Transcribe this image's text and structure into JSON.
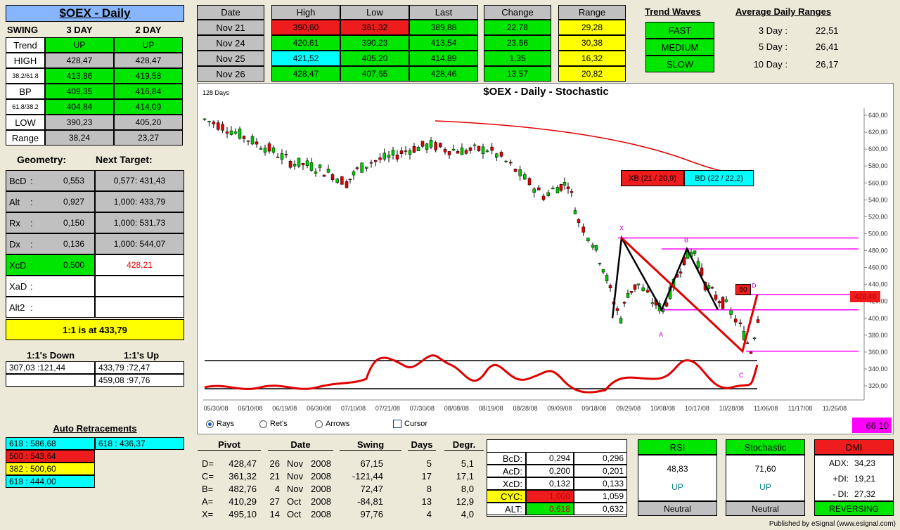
{
  "title": "$OEX - Daily",
  "swing": {
    "header": [
      "SWING",
      "3 DAY",
      "2 DAY"
    ],
    "rows": [
      {
        "label": "Trend",
        "a": "UP",
        "b": "UP"
      },
      {
        "label": "HIGH",
        "a": "428,47",
        "b": "428,47"
      },
      {
        "label": "38.2/61.8",
        "a": "413,86",
        "b": "419,58"
      },
      {
        "label": "BP",
        "a": "409,35",
        "b": "416,84"
      },
      {
        "label": "61.8/38.2",
        "a": "404,84",
        "b": "414,09"
      },
      {
        "label": "LOW",
        "a": "390,23",
        "b": "405,20"
      },
      {
        "label": "Range",
        "a": "38,24",
        "b": "23,27"
      }
    ]
  },
  "geometry": {
    "h1": "Geometry:",
    "h2": "Next Target:",
    "rows": [
      {
        "label": "BcD",
        "sep": ":",
        "val": "0,553",
        "target": "0,577: 431,43"
      },
      {
        "label": "Alt",
        "sep": ":",
        "val": "0,927",
        "target": "1,000: 433,79"
      },
      {
        "label": "Rx",
        "sep": ":",
        "val": "0,150",
        "target": "1,000: 531,73"
      },
      {
        "label": "Dx",
        "sep": ":",
        "val": "0,136",
        "target": "1,000: 544,07"
      },
      {
        "label": "XcD",
        "sep": ":",
        "val": "0,500",
        "target": "428,21"
      },
      {
        "label": "XaD",
        "sep": ":",
        "val": "",
        "target": ""
      },
      {
        "label": "Alt2",
        "sep": ":",
        "val": "",
        "target": ""
      }
    ],
    "note": "1:1 is at 433,79"
  },
  "ones": {
    "h1": "1:1's Down",
    "h2": "1:1's Up",
    "down": [
      "307,03 :121,44",
      ""
    ],
    "up": [
      "433,79 :72,47",
      "459,08 :97,76"
    ]
  },
  "auto": {
    "title": "Auto Retracements",
    "left": [
      "618 : 586,68",
      "500 : 543,64",
      "382 : 500,60",
      "618 : 444,00"
    ],
    "right": [
      "618 : 436,37"
    ]
  },
  "top": {
    "date_header": "Date",
    "dates": [
      "Nov  21",
      "Nov  24",
      "Nov  25",
      "Nov  26"
    ],
    "hll_headers": [
      "High",
      "Low",
      "Last"
    ],
    "hll": [
      [
        "390,60",
        "361,32",
        "389,88"
      ],
      [
        "420,61",
        "390,23",
        "413,54"
      ],
      [
        "421,52",
        "405,20",
        "414,89"
      ],
      [
        "428,47",
        "407,65",
        "428,46"
      ]
    ],
    "change_header": "Change",
    "change": [
      "22,78",
      "23,66",
      "1,35",
      "13,57"
    ],
    "range_header": "Range",
    "range": [
      "29,28",
      "30,38",
      "16,32",
      "20,82"
    ]
  },
  "trend_waves": {
    "title": "Trend Waves",
    "items": [
      "FAST",
      "MEDIUM",
      "SLOW"
    ]
  },
  "adr": {
    "title": "Average Daily Ranges",
    "rows": [
      {
        "label": "3 Day :",
        "val": "22,51"
      },
      {
        "label": "5 Day :",
        "val": "26,41"
      },
      {
        "label": "10 Day :",
        "val": "26,17"
      }
    ]
  },
  "chart": {
    "days_label": "128 Days",
    "title": "$OEX - Daily - Stochastic",
    "box_xb": "XB (21 / 20,9)",
    "box_bd": "BD (22 / 22,2)",
    "box_50": "50",
    "price_tag": "428,46",
    "labels": {
      "X": "X",
      "A": "A",
      "B": "B",
      "C": "C",
      "D": "D"
    },
    "y_ticks": [
      "640,00",
      "620,00",
      "600,00",
      "580,00",
      "560,00",
      "540,00",
      "520,00",
      "500,00",
      "480,00",
      "460,00",
      "440,00",
      "420,00",
      "400,00",
      "380,00",
      "360,00",
      "340,00",
      "320,00"
    ],
    "x_ticks": [
      "05/30/08",
      "06/10/08",
      "06/19/08",
      "06/30/08",
      "07/10/08",
      "07/21/08",
      "07/30/08",
      "08/08/08",
      "08/19/08",
      "08/28/08",
      "09/09/08",
      "09/18/08",
      "09/29/08",
      "10/08/08",
      "10/17/08",
      "10/28/08",
      "11/06/08",
      "11/17/08",
      "11/26/08"
    ],
    "radios": [
      "Rays",
      "Ret's",
      "Arrows"
    ],
    "cursor": "Cursor",
    "stoch_value": "66,10"
  },
  "pivot": {
    "headers": [
      "Pivot",
      "Date",
      "Swing",
      "Days",
      "Degr."
    ],
    "rows": [
      {
        "p": "D=",
        "v": "428,47",
        "d1": "26",
        "d2": "Nov",
        "d3": "2008",
        "s": "67,15",
        "days": "5",
        "deg": "5,1"
      },
      {
        "p": "C=",
        "v": "361,32",
        "d1": "21",
        "d2": "Nov",
        "d3": "2008",
        "s": "-121,44",
        "days": "17",
        "deg": "17,1"
      },
      {
        "p": "B=",
        "v": "482,76",
        "d1": "4",
        "d2": "Nov",
        "d3": "2008",
        "s": "72,47",
        "days": "8",
        "deg": "8,0"
      },
      {
        "p": "A=",
        "v": "410,29",
        "d1": "27",
        "d2": "Oct",
        "d3": "2008",
        "s": "-84,81",
        "days": "13",
        "deg": "12,9"
      },
      {
        "p": "X=",
        "v": "495,10",
        "d1": "14",
        "d2": "Oct",
        "d3": "2008",
        "s": "97,76",
        "days": "4",
        "deg": "4,0"
      }
    ]
  },
  "time": {
    "headers": [
      "Time",
      "Days",
      "DEG"
    ],
    "rows": [
      {
        "l": "BcD:",
        "days": "0,294",
        "deg": "0,296"
      },
      {
        "l": "AcD:",
        "days": "0,200",
        "deg": "0,201"
      },
      {
        "l": "XcD:",
        "days": "0,132",
        "deg": "0,133"
      },
      {
        "l": "CYC:",
        "days": "1,000",
        "deg": "1,059"
      },
      {
        "l": "ALT:",
        "days": "0,618",
        "deg": "0,632"
      }
    ]
  },
  "rsi": {
    "title": "RSI",
    "val": "48,83",
    "dir": "UP",
    "foot": "Neutral"
  },
  "stoch": {
    "title": "Stochastic",
    "val": "71,60",
    "dir": "UP",
    "foot": "Neutral"
  },
  "dmi": {
    "title": "DMI",
    "rows": [
      {
        "l": "ADX:",
        "v": "34,23"
      },
      {
        "l": "+DI:",
        "v": "19,21"
      },
      {
        "l": "- DI:",
        "v": "27,32"
      }
    ],
    "foot": "REVERSING"
  },
  "footer": "Published by eSignal (www.esignal.com)",
  "colors": {
    "up": "#00e600",
    "down": "#ee1c1c",
    "yellow": "#ffff00",
    "cyan": "#00ffff",
    "magenta": "#ff00ff",
    "bg": "#ece9d8"
  }
}
